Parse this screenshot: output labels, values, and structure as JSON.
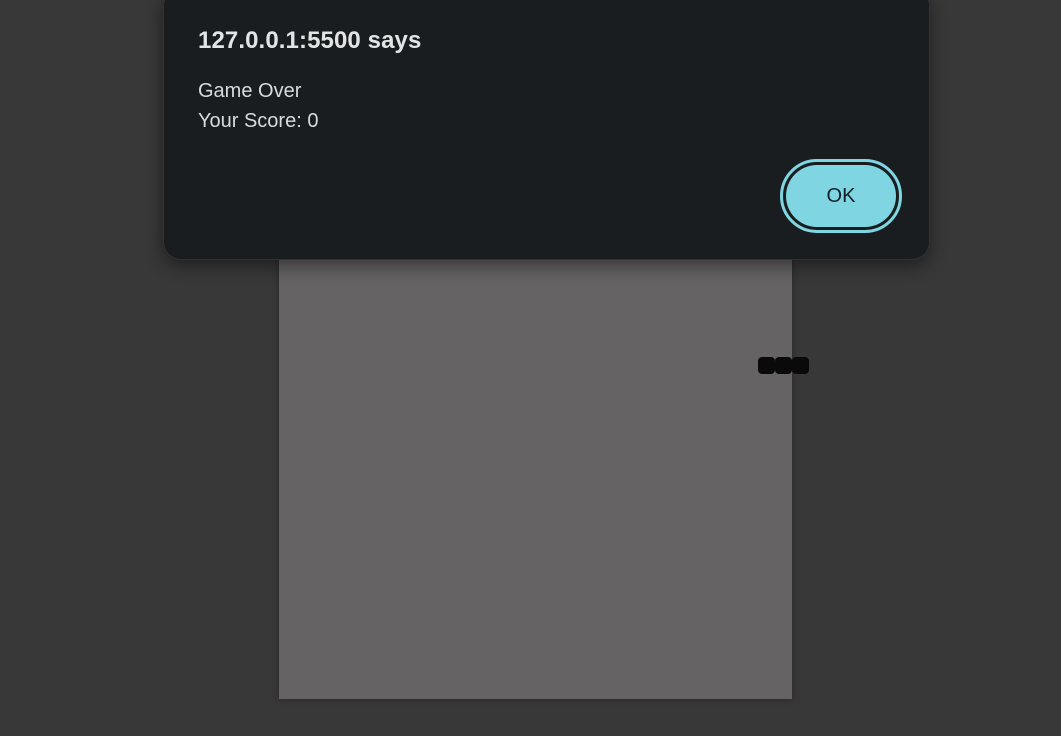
{
  "dialog": {
    "title": "127.0.0.1:5500 says",
    "message_line1": "Game Over",
    "message_line2": "Your Score: 0",
    "ok_label": "OK"
  },
  "game": {
    "snake_segments": 3,
    "colors": {
      "page_background": "#383838",
      "board": "#656364",
      "snake": "#0a0a0a",
      "dialog_background": "#1a1d1f",
      "button_accent": "#7fd6e2"
    }
  }
}
